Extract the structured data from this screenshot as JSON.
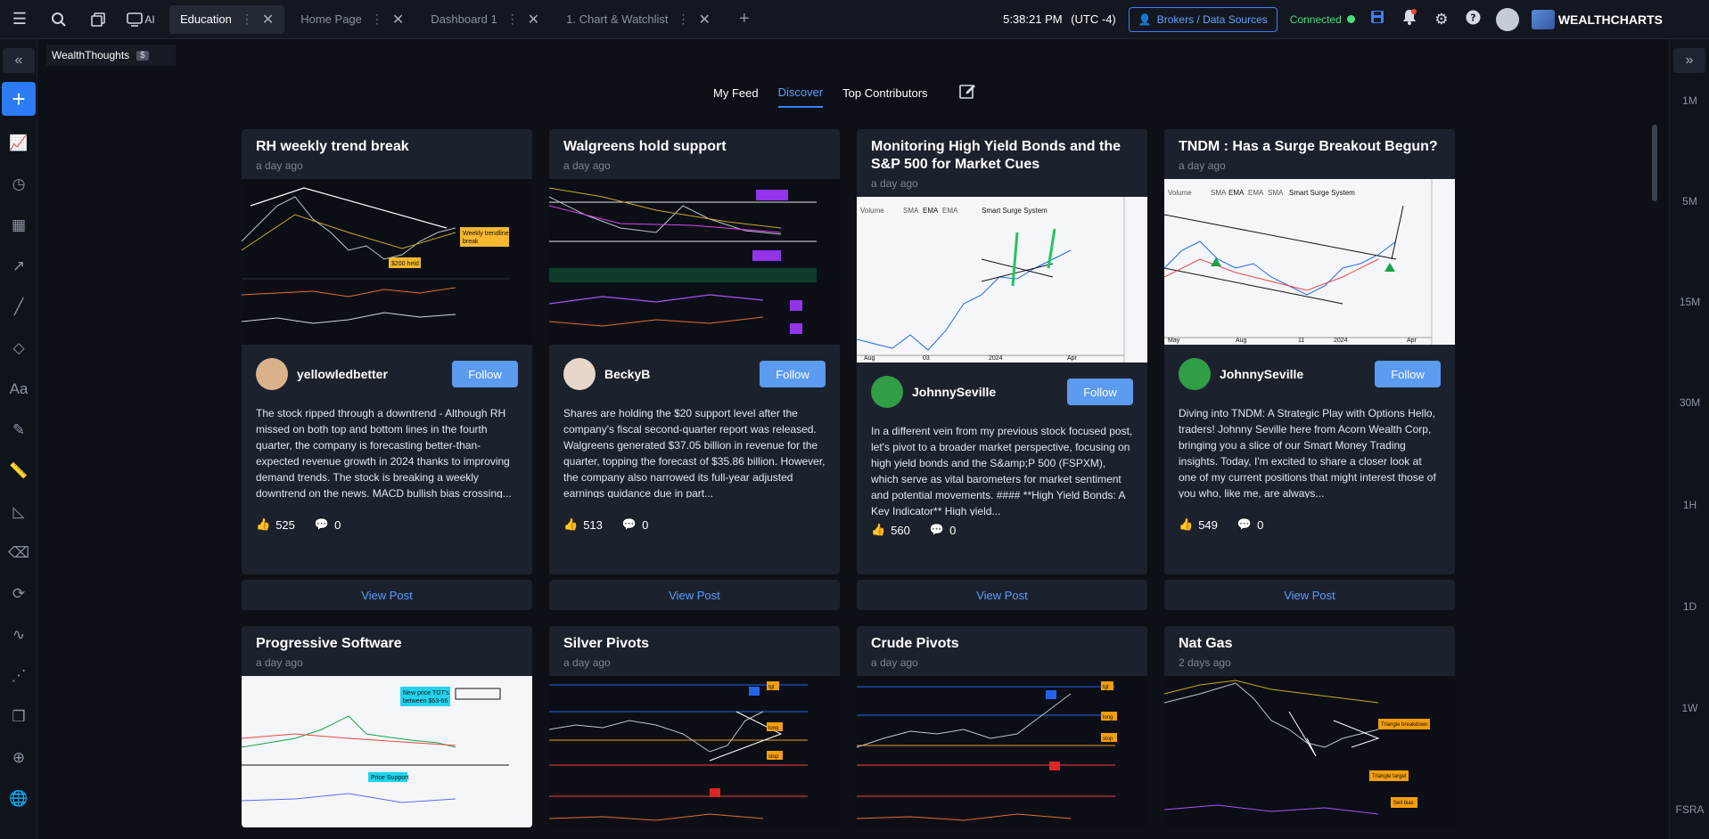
{
  "topbar": {
    "tabs": [
      {
        "label": "Education",
        "active": true
      },
      {
        "label": "Home Page",
        "active": false
      },
      {
        "label": "Dashboard 1",
        "active": false
      },
      {
        "label": "1. Chart & Watchlist",
        "active": false
      }
    ],
    "ai_label": "AI",
    "clock": "5:38:21 PM",
    "timezone": "(UTC -4)",
    "brokers_label": "Brokers / Data Sources",
    "connected_label": "Connected",
    "brand_name": "WEALTHCHARTS"
  },
  "subbar": {
    "title": "WealthThoughts",
    "badge": "$"
  },
  "nav": {
    "tabs": [
      "My Feed",
      "Discover",
      "Top Contributors"
    ],
    "active": "Discover"
  },
  "right_rail": {
    "timeframes": [
      "1M",
      "5M",
      "15M",
      "30M",
      "1H",
      "1D",
      "1W"
    ],
    "footer": "FSRA"
  },
  "cards": [
    {
      "title": "RH weekly trend break",
      "ago": "a day ago",
      "author": "yellowledbetter",
      "follow_label": "Follow",
      "body": "The stock ripped through a downtrend - Although RH missed on both top and bottom lines in the fourth quarter, the company is forecasting better-than-expected revenue growth in 2024 thanks to improving demand trends. The stock is breaking a weekly downtrend on the news. MACD bullish bias crossing...",
      "likes": "525",
      "comments": "0",
      "view_label": "View Post"
    },
    {
      "title": "Walgreens hold support",
      "ago": "a day ago",
      "author": "BeckyB",
      "follow_label": "Follow",
      "body": "Shares are holding the $20 support level after the company's fiscal second-quarter report was released. Walgreens generated $37.05 billion in revenue for the quarter, topping the forecast of $35.86 billion. However, the company also narrowed its full-year adjusted earnings guidance due in part...",
      "likes": "513",
      "comments": "0",
      "view_label": "View Post"
    },
    {
      "title": "Monitoring High Yield Bonds and the S&P 500 for Market Cues",
      "ago": "a day ago",
      "author": "JohnnySeville",
      "follow_label": "Follow",
      "body": "In a different vein from my previous stock focused post, let's pivot to a broader market perspective, focusing on high yield bonds and the S&amp;P 500 (FSPXM), which serve as vital barometers for market sentiment and potential movements. #### **High Yield Bonds: A Key Indicator** High yield...",
      "likes": "560",
      "comments": "0",
      "view_label": "View Post"
    },
    {
      "title": "TNDM : Has a Surge Breakout Begun?",
      "ago": "a day ago",
      "author": "JohnnySeville",
      "follow_label": "Follow",
      "body": "Diving into TNDM: A Strategic Play with Options Hello, traders! Johnny Seville here from Acorn Wealth Corp, bringing you a slice of our Smart Money Trading insights. Today, I'm excited to share a closer look at one of my current positions that might interest those of you who, like me, are always...",
      "likes": "549",
      "comments": "0",
      "view_label": "View Post"
    },
    {
      "title": "Progressive Software",
      "ago": "a day ago"
    },
    {
      "title": "Silver Pivots",
      "ago": "a day ago"
    },
    {
      "title": "Crude Pivots",
      "ago": "a day ago"
    },
    {
      "title": "Nat Gas",
      "ago": "2 days ago"
    }
  ],
  "thumb_labels": {
    "c0": [
      "Weekly trendline",
      "break",
      "$200 held"
    ],
    "c2": [
      "Volume",
      "SMA",
      "EMA",
      "EMA",
      "Smart Surge System",
      "Aug",
      "03",
      "2024",
      "Apr"
    ],
    "c3": [
      "Volume",
      "SMA",
      "EMA",
      "EMA",
      "SMA",
      "Smart Surge System",
      "May",
      "Aug",
      "11",
      "2024",
      "Apr"
    ],
    "c4": [
      "New price TGT's",
      "between $63-66",
      "Price Support"
    ],
    "c5": [
      "tgt",
      "long",
      "stop"
    ],
    "c6": [
      "tgt",
      "long",
      "stop"
    ],
    "c7": [
      "Triangle breakdown",
      "Triangle target",
      "Sell bias"
    ]
  },
  "colors": {
    "accent": "#3b82f6",
    "connected": "#4ade80",
    "card_bg": "#1c222d"
  }
}
